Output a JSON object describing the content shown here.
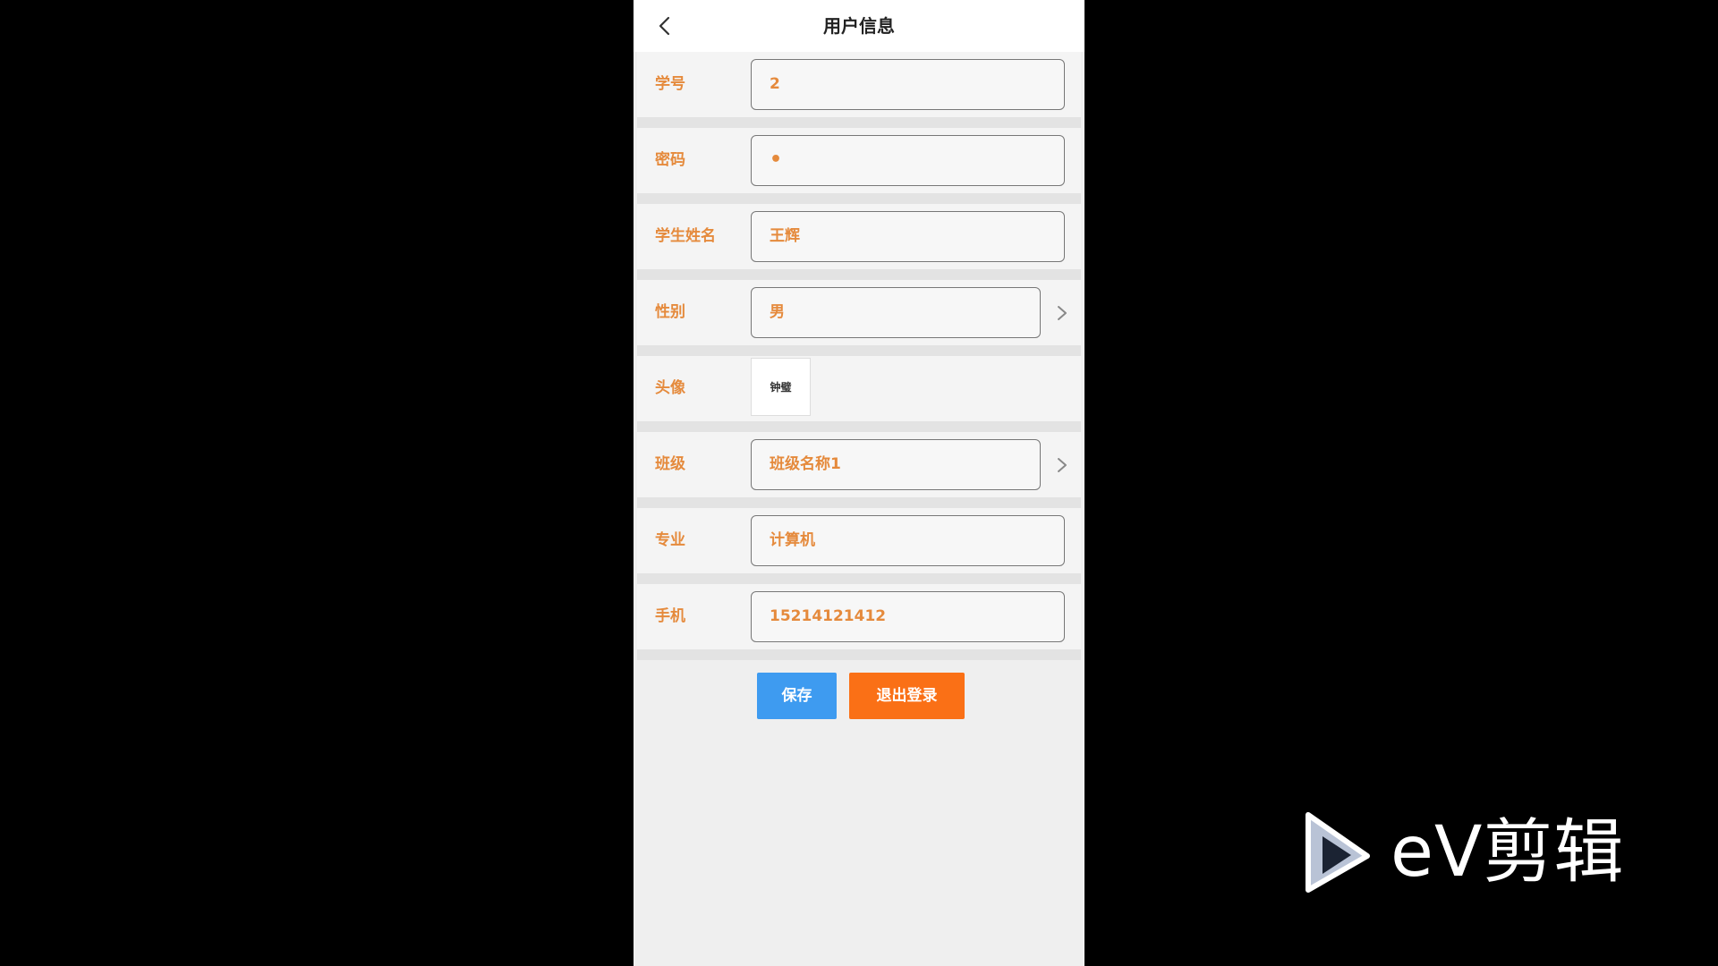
{
  "header": {
    "title": "用户信息",
    "back_icon": "chevron-left-icon"
  },
  "form": {
    "student_id": {
      "label": "学号",
      "value": "2"
    },
    "password": {
      "label": "密码",
      "value": "•"
    },
    "student_name": {
      "label": "学生姓名",
      "value": "王辉"
    },
    "gender": {
      "label": "性别",
      "value": "男",
      "icon": "chevron-right-icon"
    },
    "avatar": {
      "label": "头像",
      "image_text": "钟璧"
    },
    "class": {
      "label": "班级",
      "value": "班级名称1",
      "icon": "chevron-right-icon"
    },
    "major": {
      "label": "专业",
      "value": "计算机"
    },
    "phone": {
      "label": "手机",
      "value": "15214121412"
    }
  },
  "actions": {
    "save_label": "保存",
    "logout_label": "退出登录"
  },
  "colors": {
    "label": "#e58a3c",
    "save_button": "#3e9bf0",
    "logout_button": "#fa7016",
    "page_background": "#efefef"
  },
  "watermark": {
    "text": "eV剪辑",
    "icon": "play-logo-icon"
  }
}
